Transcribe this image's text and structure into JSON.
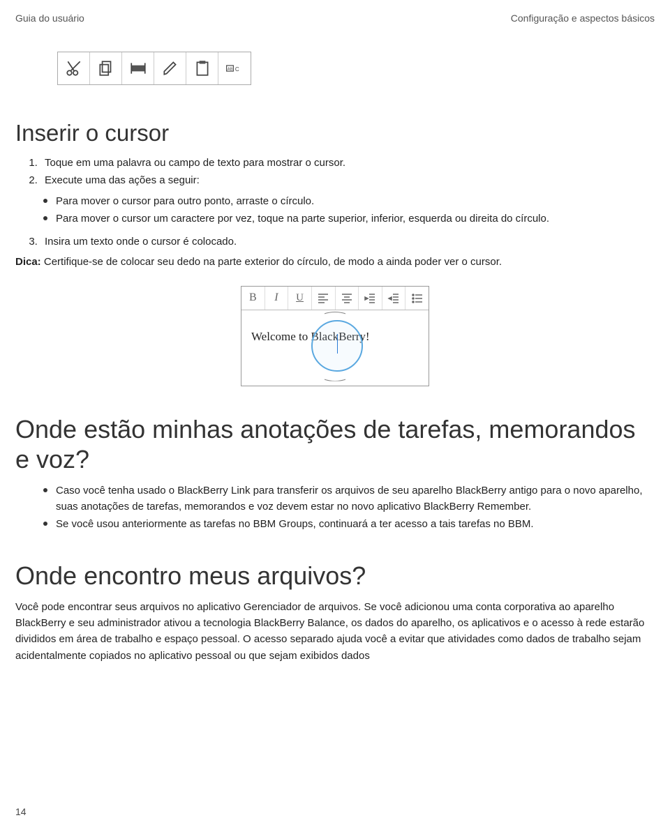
{
  "header": {
    "left": "Guia do usuário",
    "right": "Configuração e aspectos básicos"
  },
  "toolbar1_icons": [
    "cut-icon",
    "copy-icon",
    "select-icon",
    "edit-icon",
    "paste-icon",
    "spellcheck-icon"
  ],
  "section1": {
    "title": "Inserir o cursor",
    "steps": [
      "Toque em uma palavra ou campo de texto para mostrar o cursor.",
      "Execute uma das ações a seguir:"
    ],
    "sub_bullets": [
      "Para mover o cursor para outro ponto, arraste o círculo.",
      "Para mover o cursor um caractere por vez, toque na parte superior, inferior, esquerda ou direita do círculo."
    ],
    "step3": "Insira um texto onde o cursor é colocado.",
    "tip_label": "Dica:",
    "tip_text": " Certifique-se de colocar seu dedo na parte exterior do círculo, de modo a ainda poder ver o cursor."
  },
  "editor": {
    "icons": [
      "bold-icon",
      "italic-icon",
      "underline-icon",
      "align-left-icon",
      "align-center-icon",
      "indent-right-icon",
      "indent-left-icon",
      "list-icon"
    ],
    "body_text": "Welcome to BlackBerry!"
  },
  "section2": {
    "title": "Onde estão minhas anotações de tarefas, memorandos e voz?",
    "bullets": [
      "Caso você tenha usado o BlackBerry Link para transferir os arquivos de seu aparelho BlackBerry antigo para o novo aparelho, suas anotações de tarefas, memorandos e voz devem estar no novo aplicativo BlackBerry Remember.",
      "Se você usou anteriormente as tarefas no BBM Groups, continuará a ter acesso a tais tarefas no BBM."
    ]
  },
  "section3": {
    "title": "Onde encontro meus arquivos?",
    "para": "Você pode encontrar seus arquivos no aplicativo Gerenciador de arquivos. Se você adicionou uma conta corporativa ao aparelho BlackBerry e seu administrador ativou a tecnologia BlackBerry Balance, os dados do aparelho, os aplicativos e o acesso à rede estarão divididos em área de trabalho e espaço pessoal. O acesso separado ajuda você a evitar que atividades como dados de trabalho sejam acidentalmente copiados no aplicativo pessoal ou que sejam exibidos dados"
  },
  "page_number": "14"
}
